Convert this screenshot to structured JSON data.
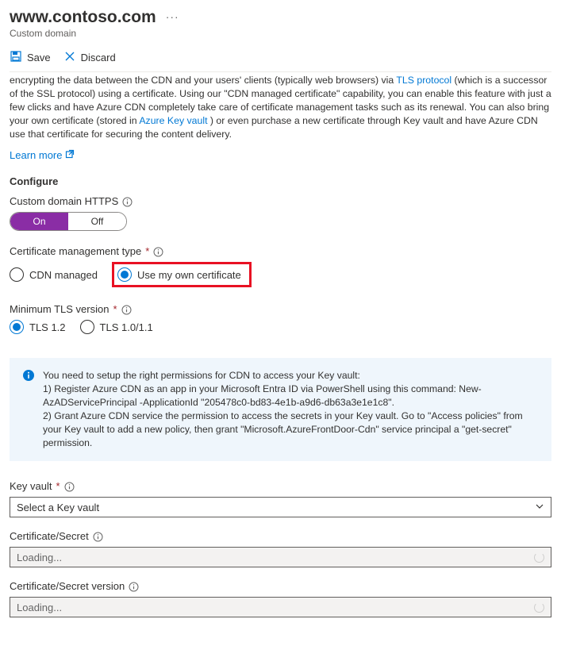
{
  "header": {
    "title": "www.contoso.com",
    "subtitle": "Custom domain"
  },
  "toolbar": {
    "save_label": "Save",
    "discard_label": "Discard"
  },
  "intro": {
    "text_before_tls": "encrypting the data between the CDN and your users' clients (typically web browsers) via ",
    "tls_link": "TLS protocol",
    "text_mid": " (which is a successor of the SSL protocol) using a certificate. Using our \"CDN managed certificate\" capability, you can enable this feature with just a few clicks and have Azure CDN completely take care of certificate management tasks such as its renewal. You can also bring your own certificate (stored in ",
    "akv_link": "Azure Key vault",
    "text_end": " ) or even purchase a new certificate through Key vault and have Azure CDN use that certificate for securing the content delivery.",
    "learn_more": "Learn more"
  },
  "configure": {
    "heading": "Configure",
    "https_label": "Custom domain HTTPS",
    "toggle_on": "On",
    "toggle_off": "Off",
    "cert_type_label": "Certificate management type",
    "cert_type_options": {
      "cdn_managed": "CDN managed",
      "own_cert": "Use my own certificate"
    },
    "tls_label": "Minimum TLS version",
    "tls_options": {
      "tls12": "TLS 1.2",
      "tls1011": "TLS 1.0/1.1"
    }
  },
  "callout": {
    "line1": "You need to setup the right permissions for CDN to access your Key vault:",
    "line2": "1) Register Azure CDN as an app in your Microsoft Entra ID via PowerShell using this command: New-AzADServicePrincipal -ApplicationId \"205478c0-bd83-4e1b-a9d6-db63a3e1e1c8\".",
    "line3": "2) Grant Azure CDN service the permission to access the secrets in your Key vault. Go to \"Access policies\" from your Key vault to add a new policy, then grant \"Microsoft.AzureFrontDoor-Cdn\" service principal a \"get-secret\" permission."
  },
  "fields": {
    "key_vault_label": "Key vault",
    "key_vault_placeholder": "Select a Key vault",
    "cert_secret_label": "Certificate/Secret",
    "cert_secret_version_label": "Certificate/Secret version",
    "loading_text": "Loading..."
  }
}
